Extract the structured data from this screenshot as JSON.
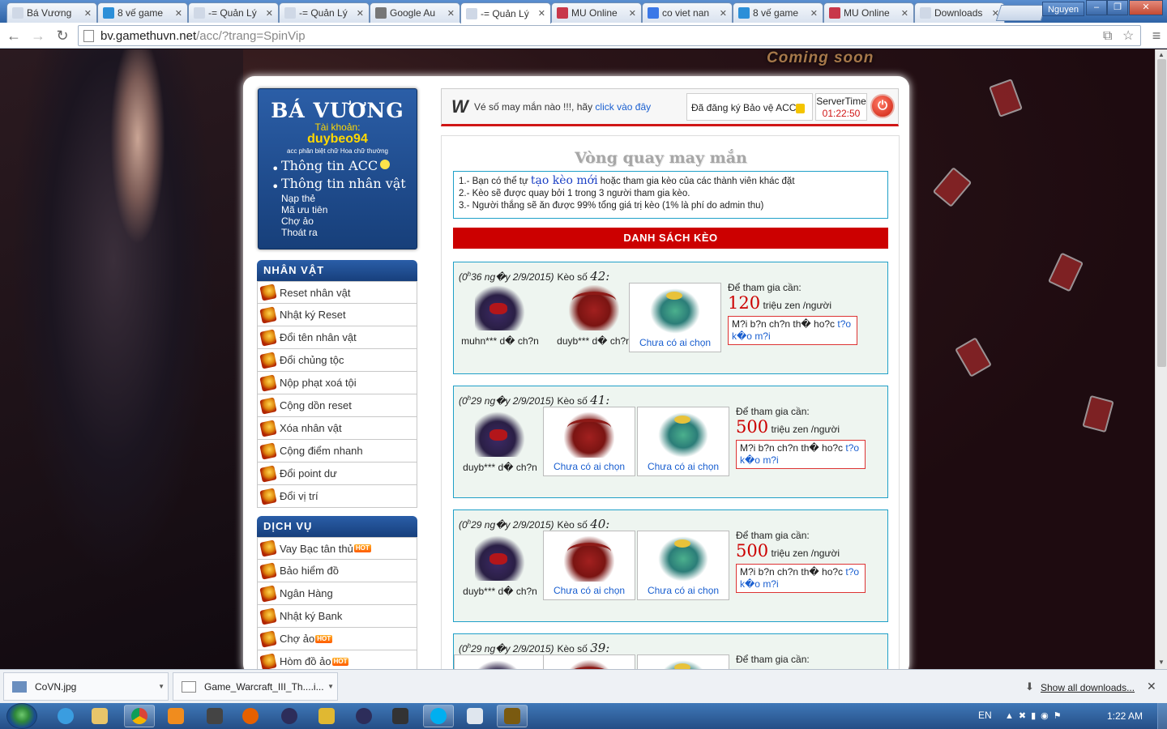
{
  "browser": {
    "tabs": [
      {
        "title": "Bá Vương",
        "icon": "page-icon",
        "color": "#cfd8e6"
      },
      {
        "title": "8 vế game",
        "icon": "g-icon",
        "color": "#2c8fd8"
      },
      {
        "title": "-= Quản Lý",
        "icon": "page-icon",
        "color": "#cfd8e6"
      },
      {
        "title": "-= Quản Lý",
        "icon": "page-icon",
        "color": "#cfd8e6"
      },
      {
        "title": "Google Au",
        "icon": "github-icon",
        "color": "#777777"
      },
      {
        "title": "-= Quản Lý",
        "icon": "page-icon",
        "color": "#cfd8e6",
        "active": true
      },
      {
        "title": "MU Online",
        "icon": "mu-icon",
        "color": "#c8374a"
      },
      {
        "title": "co viet nan",
        "icon": "google-icon",
        "color": "#3b78e7"
      },
      {
        "title": "8 vế game",
        "icon": "g-icon",
        "color": "#2c8fd8"
      },
      {
        "title": "MU Online",
        "icon": "mu-icon",
        "color": "#c8374a"
      },
      {
        "title": "Downloads",
        "icon": "download-icon",
        "color": "#cfd8e6"
      }
    ],
    "user": "Nguyen",
    "url_host": "bv.gamethuvn.net",
    "url_path": "/acc/?trang=SpinVip"
  },
  "background": {
    "banner": "Coming soon"
  },
  "brand": {
    "title": "BÁ VƯƠNG",
    "account_label": "Tài khoản:",
    "username": "duybeo94",
    "note": "acc phân biệt chữ Hoa chữ thường",
    "menu": [
      {
        "label": "Thông tin ACC",
        "size": "big"
      },
      {
        "label": "Thông tin nhân vật",
        "size": "big"
      },
      {
        "label": "Nạp thẻ",
        "size": "small"
      },
      {
        "label": "Mã ưu tiên",
        "size": "small"
      },
      {
        "label": "Chợ ảo",
        "size": "small"
      },
      {
        "label": "Thoát ra",
        "size": "small"
      }
    ]
  },
  "sections": {
    "character": {
      "title": "NHÂN VẬT",
      "items": [
        "Reset nhân vật",
        "Nhật ký Reset",
        "Đổi tên nhân vật",
        "Đổi chủng tộc",
        "Nộp phạt xoá tội",
        "Cộng dồn reset",
        "Xóa nhân vật",
        "Cộng điểm nhanh",
        "Đổi point dư",
        "Đổi vị trí"
      ]
    },
    "service": {
      "title": "DỊCH VỤ",
      "items": [
        {
          "label": "Vay Bạc tân thủ",
          "hot": true
        },
        {
          "label": "Bảo hiểm đồ",
          "hot": false
        },
        {
          "label": "Ngân Hàng",
          "hot": false
        },
        {
          "label": "Nhật ký Bank",
          "hot": false
        },
        {
          "label": "Chợ ảo",
          "hot": true
        },
        {
          "label": "Hòm đồ ảo",
          "hot": true
        }
      ],
      "hot_label": "HOT"
    }
  },
  "topbar": {
    "logo": "W",
    "lucky_text": "Vé số may mắn nào !!!, hãy ",
    "lucky_link": "click vào đây",
    "protect": "Đã đăng ký Bảo vệ ACC",
    "servertime_label": "ServerTime",
    "servertime_value": "01:22:50"
  },
  "content": {
    "title": "Vòng quay may mắn",
    "rules": {
      "line1_pre": "1.- Bạn có thể tự ",
      "line1_link": "tạo kèo mới",
      "line1_post": " hoặc tham gia kèo của các thành viên khác đặt",
      "line2": "2.- Kèo sẽ được quay bởi 1 trong 3 người tham gia kèo.",
      "line3": "3.- Người thắng sẽ ăn được 99% tổng giá trị kèo (1% là phí do admin thu)"
    },
    "list_header": "DANH SÁCH KÈO",
    "keo_label": "Kèo số",
    "req_label": "Để tham gia cần:",
    "unit": "triệu zen /người",
    "choose_text": "M?i b?n ch?n th� ho?c ",
    "choose_link": "t?o k�o m?i",
    "empty": "Chưa có ai chọn",
    "keos": [
      {
        "date_pre": "(0",
        "date_sup": "h",
        "date_post": "36 ng�y 2/9/2015)",
        "num": "42:",
        "price": "120",
        "players": [
          "muhn*** d� ch?n",
          "duyb*** d� ch?n"
        ]
      },
      {
        "date_pre": "(0",
        "date_sup": "h",
        "date_post": "29 ng�y 2/9/2015)",
        "num": "41:",
        "price": "500",
        "players": [
          "duyb*** d� ch?n"
        ]
      },
      {
        "date_pre": "(0",
        "date_sup": "h",
        "date_post": "29 ng�y 2/9/2015)",
        "num": "40:",
        "price": "500",
        "players": [
          "duyb*** d� ch?n"
        ]
      },
      {
        "date_pre": "(0",
        "date_sup": "h",
        "date_post": "29 ng�y 2/9/2015)",
        "num": "39:",
        "price": "",
        "players": []
      }
    ]
  },
  "downloads": {
    "items": [
      "CoVN.jpg",
      "Game_Warcraft_III_Th....i..."
    ],
    "show_all": "Show all downloads..."
  },
  "taskbar": {
    "lang": "EN",
    "clock": "1:22 AM"
  }
}
